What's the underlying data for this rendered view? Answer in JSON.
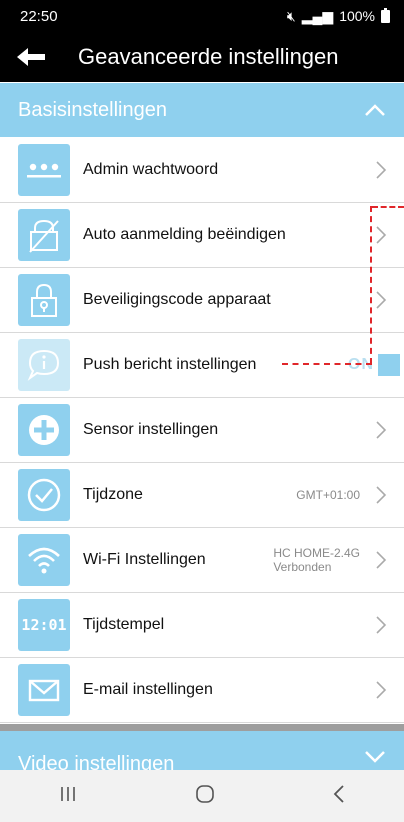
{
  "status_bar": {
    "time": "22:50",
    "battery": "100%"
  },
  "app_bar": {
    "title": "Geavanceerde instellingen"
  },
  "sections": {
    "basic": {
      "title": "Basisinstellingen"
    },
    "video": {
      "title": "Video instellingen"
    }
  },
  "settings": [
    {
      "label": "Admin wachtwoord",
      "icon": "password-dots-icon"
    },
    {
      "label": "Auto aanmelding beëindigen",
      "icon": "auto-login-off-icon"
    },
    {
      "label": "Beveiligingscode apparaat",
      "icon": "security-lock-icon"
    },
    {
      "label": "Push bericht instellingen",
      "icon": "push-message-icon",
      "toggle": "ON"
    },
    {
      "label": "Sensor instellingen",
      "icon": "sensor-plus-icon"
    },
    {
      "label": "Tijdzone",
      "icon": "timezone-check-icon",
      "value": "GMT+01:00"
    },
    {
      "label": "Wi-Fi Instellingen",
      "icon": "wifi-icon",
      "value": "HC HOME-2.4G",
      "value2": "Verbonden"
    },
    {
      "label": "Tijdstempel",
      "icon": "timestamp-icon",
      "icon_text": "12:01"
    },
    {
      "label": "E-mail instellingen",
      "icon": "email-icon"
    }
  ],
  "colors": {
    "accent": "#8fd0ee",
    "annotation": "#e0262a"
  }
}
